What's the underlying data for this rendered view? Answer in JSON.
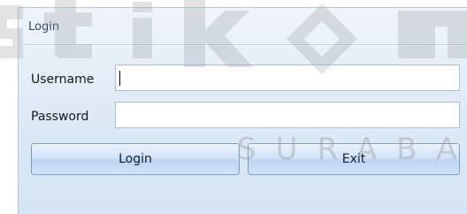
{
  "panel": {
    "title": "Login"
  },
  "form": {
    "username_label": "Username",
    "username_value": "",
    "password_label": "Password",
    "password_value": ""
  },
  "buttons": {
    "login_label": "Login",
    "exit_label": "Exit"
  },
  "watermark": {
    "word_top": "stikom",
    "word_bottom": "SURABAYA"
  },
  "colors": {
    "panel_bg": "#dce8f5",
    "border": "#a9c0da",
    "button": "#cfe1f6"
  }
}
